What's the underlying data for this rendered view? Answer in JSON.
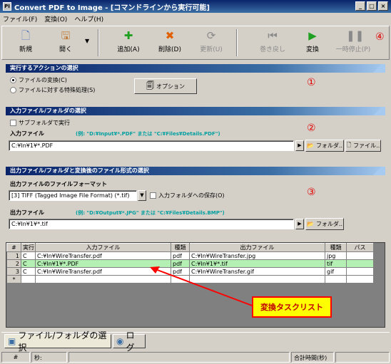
{
  "window": {
    "title": "Convert PDF to Image - [コマンドラインから実行可能]",
    "app_icon_text": "PI",
    "minimize": "_",
    "maximize": "□",
    "close": "×"
  },
  "menu": [
    "ファイル(F)",
    "変換(O)",
    "ヘルプ(H)"
  ],
  "toolbar": {
    "new": "新規",
    "open": "開く",
    "add": "追加(A)",
    "delete": "削除(D)",
    "update": "更新(U)",
    "rewind": "巻き戻し",
    "convert": "変換",
    "pause": "一時停止(P)",
    "icons": {
      "new": "document-icon",
      "open": "floppy-icon",
      "add": "plus-icon",
      "delete": "x-icon",
      "update": "refresh-icon",
      "rewind": "rewind-icon",
      "convert": "play-icon",
      "pause": "pause-icon"
    }
  },
  "annotations": {
    "n1": "①",
    "n2": "②",
    "n3": "③",
    "n4": "④"
  },
  "action": {
    "header": "実行するアクションの選択",
    "radio_convert": "ファイルの変換(C)",
    "radio_special": "ファイルに対する特殊処理(S)",
    "options_button": "オプション"
  },
  "input": {
    "header": "入力ファイル/フォルダの選択",
    "subfolder": "サブフォルダで実行",
    "file_label": "入力ファイル",
    "example": "(例: \"D:¥Input¥*.PDF\" または \"C:¥Files¥Details.PDF\")",
    "value": "C:¥In¥1¥*.PDF",
    "folder_btn": "フォルダ..",
    "file_btn": "ファイル.."
  },
  "output": {
    "header": "出力ファイル/フォルダと変換後のファイル形式の選択",
    "format_label": "出力ファイルのファイルフォーマット",
    "format_value": "[3] TIFF (Tagged Image File Format) (*.tif)",
    "save_to_input": "入力フォルダへの保存(O)",
    "file_label": "出力ファイル",
    "example": "(例: \"D:¥Output¥*.JPG\" または \"C:¥Files¥Details.BMP\")",
    "value": "C:¥In¥1¥*.tif",
    "folder_btn": "フォルダ.."
  },
  "tasks": {
    "columns": [
      "#",
      "実行",
      "入力ファイル",
      "種類",
      "出力ファイル",
      "種類",
      "パス"
    ],
    "rows": [
      [
        "1",
        "C",
        "C:¥In¥WireTransfer.pdf",
        "pdf",
        "C:¥In¥WireTransfer.jpg",
        "jpg",
        ""
      ],
      [
        "2",
        "C",
        "C:¥In¥1¥*.PDF",
        "pdf",
        "C:¥In¥1¥*.tif",
        "tif",
        ""
      ],
      [
        "3",
        "C",
        "C:¥In¥WireTransfer.pdf",
        "pdf",
        "C:¥In¥WireTransfer.gif",
        "gif",
        ""
      ],
      [
        "*",
        "",
        "",
        "",
        "",
        "",
        ""
      ]
    ],
    "callout": "変換タスクリスト"
  },
  "tabs": [
    "ファイル/フォルダの選択",
    "ログ"
  ],
  "status": {
    "hash": "#",
    "step": "秒:",
    "total": "合計時間(秒)"
  },
  "colors": {
    "selected_row": "#b4f0b4",
    "annotation": "#e00000",
    "callout_bg": "#ffff00"
  }
}
